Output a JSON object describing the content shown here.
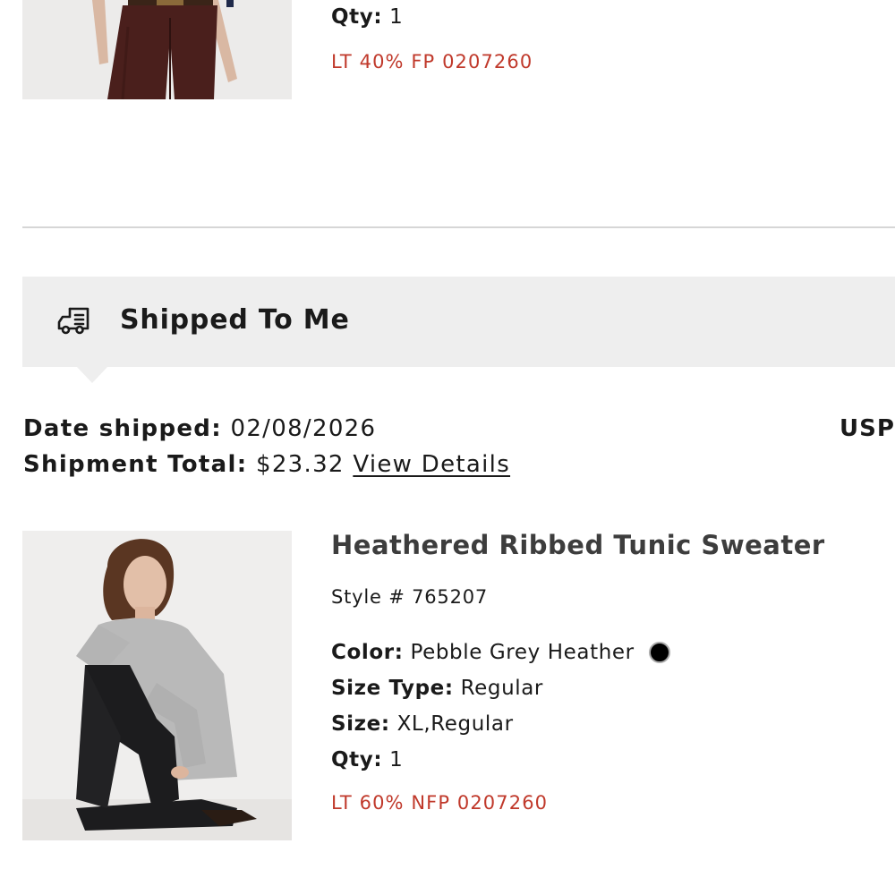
{
  "colors": {
    "text": "#1a1a1a",
    "promo_red": "#c0392b",
    "header_bg": "#eeeeee",
    "divider": "#d6d6d6",
    "swatch": "#000000",
    "product_title": "#3d3d3d"
  },
  "prev_item": {
    "qty_label": "Qty:",
    "qty_value": "1",
    "promo": "LT 40% FP 0207260",
    "image_icon": "brown-trousers-photo"
  },
  "shipment": {
    "header_icon": "delivery-truck-icon",
    "title": "Shipped To Me",
    "date_label": "Date shipped:",
    "date_value": "02/08/2026",
    "total_label": "Shipment Total:",
    "total_value": "$23.32",
    "view_details": "View Details",
    "carrier": "USPS"
  },
  "product": {
    "name": "Heathered Ribbed Tunic Sweater",
    "style": "Style # 765207",
    "color_label": "Color:",
    "color_value": "Pebble Grey Heather",
    "size_type_label": "Size Type:",
    "size_type_value": "Regular",
    "size_label": "Size:",
    "size_value": "XL,Regular",
    "qty_label": "Qty:",
    "qty_value": "1",
    "promo": "LT 60% NFP 0207260",
    "image_icon": "grey-sweater-model-photo"
  }
}
